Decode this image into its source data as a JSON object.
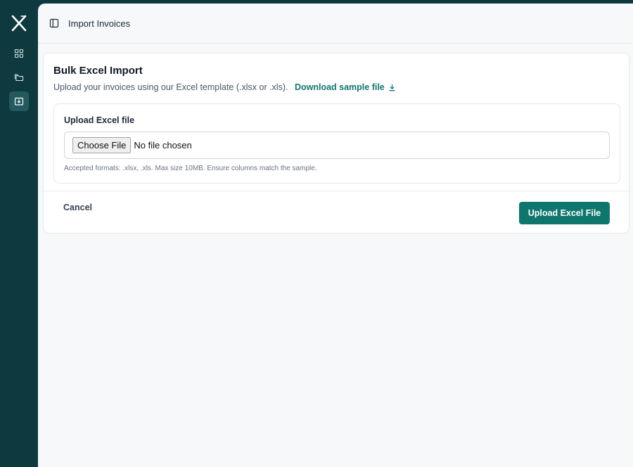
{
  "sidebar": {
    "logo_icon": "x-logo-icon",
    "items": [
      {
        "icon": "grid-icon",
        "active": false
      },
      {
        "icon": "folders-icon",
        "active": false
      },
      {
        "icon": "inbox-download-icon",
        "active": true
      }
    ]
  },
  "header": {
    "toggle_icon": "sidebar-toggle-icon",
    "breadcrumb": "Import Invoices"
  },
  "card": {
    "title": "Bulk Excel Import",
    "description": "Upload your invoices using our Excel template (.xlsx or .xls).",
    "download_link": "Download sample file",
    "upload": {
      "label": "Upload Excel file",
      "choose_button": "Choose File",
      "file_status": "No file chosen",
      "help_text": "Accepted formats: .xlsx, .xls. Max size 10MB. Ensure columns match the sample."
    },
    "footer": {
      "cancel_label": "Cancel",
      "submit_label": "Upload Excel File"
    }
  },
  "colors": {
    "sidebar_bg": "#0e3a3f",
    "accent": "#0f766e",
    "page_bg": "#f7f8f9"
  }
}
